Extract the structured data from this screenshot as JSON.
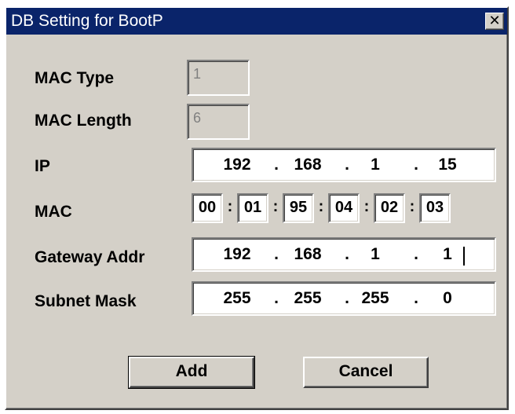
{
  "dialog": {
    "title": "DB Setting for BootP",
    "close_glyph": "✕"
  },
  "fields": {
    "mac_type": {
      "label": "MAC Type",
      "value": "1"
    },
    "mac_length": {
      "label": "MAC Length",
      "value": "6"
    },
    "ip": {
      "label": "IP",
      "octets": [
        "192",
        "168",
        "1",
        "15"
      ],
      "separator": "."
    },
    "mac": {
      "label": "MAC",
      "bytes": [
        "00",
        "01",
        "95",
        "04",
        "02",
        "03"
      ],
      "separator": ":"
    },
    "gateway": {
      "label": "Gateway Addr",
      "octets": [
        "192",
        "168",
        "1",
        "1"
      ],
      "separator": "."
    },
    "subnet": {
      "label": "Subnet Mask",
      "octets": [
        "255",
        "255",
        "255",
        "0"
      ],
      "separator": "."
    }
  },
  "buttons": {
    "add": "Add",
    "cancel": "Cancel"
  }
}
